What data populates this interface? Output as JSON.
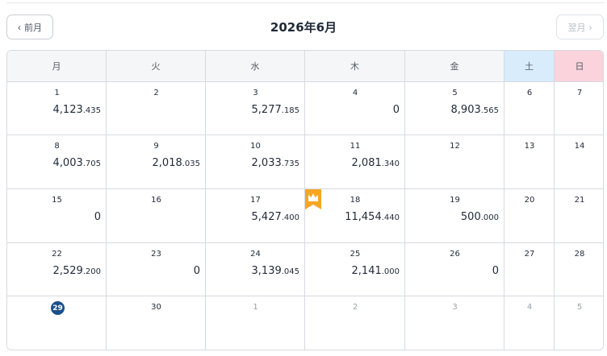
{
  "header": {
    "prev_label": "前月",
    "title": "2026年6月",
    "next_label": "翌月"
  },
  "weekdays": [
    "月",
    "火",
    "水",
    "木",
    "金",
    "土",
    "日"
  ],
  "colors": {
    "accent": "#1b4f8a",
    "crown": "#f5a623",
    "saturday": "#d8ecfb",
    "sunday": "#fbd3dc"
  },
  "weeks": [
    [
      {
        "day": "1",
        "int": "4,123",
        "dec": ".435"
      },
      {
        "day": "2"
      },
      {
        "day": "3",
        "int": "5,277",
        "dec": ".185"
      },
      {
        "day": "4",
        "int": "0"
      },
      {
        "day": "5",
        "int": "8,903",
        "dec": ".565"
      },
      {
        "day": "6"
      },
      {
        "day": "7"
      }
    ],
    [
      {
        "day": "8",
        "int": "4,003",
        "dec": ".705"
      },
      {
        "day": "9",
        "int": "2,018",
        "dec": ".035"
      },
      {
        "day": "10",
        "int": "2,033",
        "dec": ".735"
      },
      {
        "day": "11",
        "int": "2,081",
        "dec": ".340"
      },
      {
        "day": "12"
      },
      {
        "day": "13"
      },
      {
        "day": "14"
      }
    ],
    [
      {
        "day": "15",
        "int": "0"
      },
      {
        "day": "16"
      },
      {
        "day": "17",
        "int": "5,427",
        "dec": ".400"
      },
      {
        "day": "18",
        "int": "11,454",
        "dec": ".440",
        "crown": true
      },
      {
        "day": "19",
        "int": "500",
        "dec": ".000"
      },
      {
        "day": "20"
      },
      {
        "day": "21"
      }
    ],
    [
      {
        "day": "22",
        "int": "2,529",
        "dec": ".200"
      },
      {
        "day": "23",
        "int": "0"
      },
      {
        "day": "24",
        "int": "3,139",
        "dec": ".045"
      },
      {
        "day": "25",
        "int": "2,141",
        "dec": ".000"
      },
      {
        "day": "26",
        "int": "0"
      },
      {
        "day": "27"
      },
      {
        "day": "28"
      }
    ],
    [
      {
        "day": "29",
        "today": true
      },
      {
        "day": "30"
      },
      {
        "day": "1",
        "other": true
      },
      {
        "day": "2",
        "other": true
      },
      {
        "day": "3",
        "other": true
      },
      {
        "day": "4",
        "other": true
      },
      {
        "day": "5",
        "other": true
      }
    ]
  ]
}
